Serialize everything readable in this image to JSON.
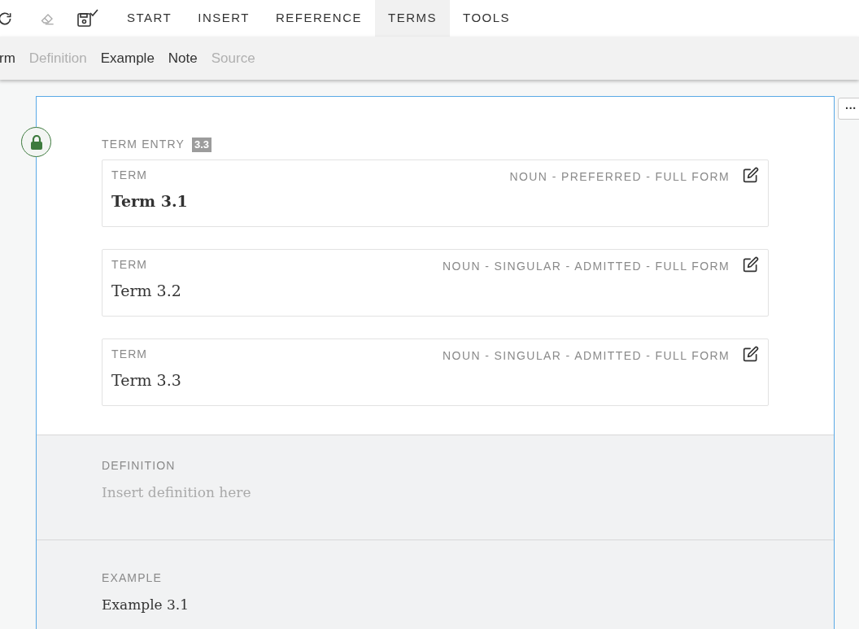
{
  "menu_tabs": [
    {
      "label": "START",
      "selected": false
    },
    {
      "label": "INSERT",
      "selected": false
    },
    {
      "label": "REFERENCE",
      "selected": false
    },
    {
      "label": "TERMS",
      "selected": true
    },
    {
      "label": "TOOLS",
      "selected": false
    }
  ],
  "ribbon": [
    {
      "label": "rm",
      "disabled": false
    },
    {
      "label": "Definition",
      "disabled": true
    },
    {
      "label": "Example",
      "disabled": false
    },
    {
      "label": "Note",
      "disabled": false
    },
    {
      "label": "Source",
      "disabled": true
    }
  ],
  "more_button": "···",
  "entry": {
    "label": "TERM ENTRY",
    "number": "3.3",
    "locked": true,
    "terms": [
      {
        "label": "TERM",
        "meta": "NOUN - PREFERRED - FULL FORM",
        "value": "Term 3.1",
        "preferred": true
      },
      {
        "label": "TERM",
        "meta": "NOUN - SINGULAR - ADMITTED - FULL FORM",
        "value": "Term 3.2",
        "preferred": false
      },
      {
        "label": "TERM",
        "meta": "NOUN - SINGULAR - ADMITTED - FULL FORM",
        "value": "Term 3.3",
        "preferred": false
      }
    ],
    "definition": {
      "label": "DEFINITION",
      "placeholder": "Insert definition here"
    },
    "example": {
      "label": "EXAMPLE",
      "value": "Example 3.1"
    }
  }
}
